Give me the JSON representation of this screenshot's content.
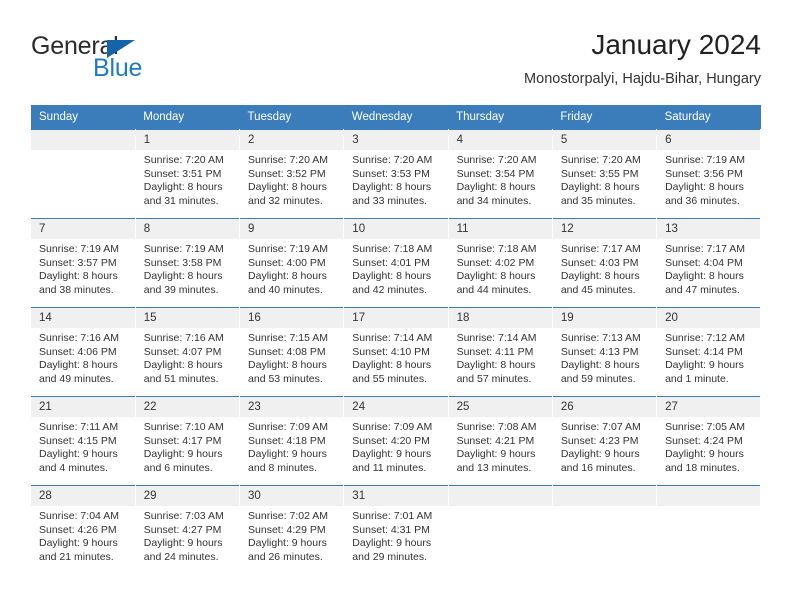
{
  "brand": {
    "name_part1": "General",
    "name_part2": "Blue",
    "logo_icon": "triangle-icon",
    "accent_color": "#1f7bc4"
  },
  "header": {
    "title": "January 2024",
    "subtitle": "Monostorpalyi, Hajdu-Bihar, Hungary"
  },
  "calendar": {
    "header_bg": "#3a7dba",
    "daynum_bg": "#f0f0f0",
    "weekdays": [
      "Sunday",
      "Monday",
      "Tuesday",
      "Wednesday",
      "Thursday",
      "Friday",
      "Saturday"
    ],
    "weeks": [
      [
        {
          "day": "",
          "sunrise": "",
          "sunset": "",
          "daylight_line1": "",
          "daylight_line2": ""
        },
        {
          "day": "1",
          "sunrise": "Sunrise: 7:20 AM",
          "sunset": "Sunset: 3:51 PM",
          "daylight_line1": "Daylight: 8 hours",
          "daylight_line2": "and 31 minutes."
        },
        {
          "day": "2",
          "sunrise": "Sunrise: 7:20 AM",
          "sunset": "Sunset: 3:52 PM",
          "daylight_line1": "Daylight: 8 hours",
          "daylight_line2": "and 32 minutes."
        },
        {
          "day": "3",
          "sunrise": "Sunrise: 7:20 AM",
          "sunset": "Sunset: 3:53 PM",
          "daylight_line1": "Daylight: 8 hours",
          "daylight_line2": "and 33 minutes."
        },
        {
          "day": "4",
          "sunrise": "Sunrise: 7:20 AM",
          "sunset": "Sunset: 3:54 PM",
          "daylight_line1": "Daylight: 8 hours",
          "daylight_line2": "and 34 minutes."
        },
        {
          "day": "5",
          "sunrise": "Sunrise: 7:20 AM",
          "sunset": "Sunset: 3:55 PM",
          "daylight_line1": "Daylight: 8 hours",
          "daylight_line2": "and 35 minutes."
        },
        {
          "day": "6",
          "sunrise": "Sunrise: 7:19 AM",
          "sunset": "Sunset: 3:56 PM",
          "daylight_line1": "Daylight: 8 hours",
          "daylight_line2": "and 36 minutes."
        }
      ],
      [
        {
          "day": "7",
          "sunrise": "Sunrise: 7:19 AM",
          "sunset": "Sunset: 3:57 PM",
          "daylight_line1": "Daylight: 8 hours",
          "daylight_line2": "and 38 minutes."
        },
        {
          "day": "8",
          "sunrise": "Sunrise: 7:19 AM",
          "sunset": "Sunset: 3:58 PM",
          "daylight_line1": "Daylight: 8 hours",
          "daylight_line2": "and 39 minutes."
        },
        {
          "day": "9",
          "sunrise": "Sunrise: 7:19 AM",
          "sunset": "Sunset: 4:00 PM",
          "daylight_line1": "Daylight: 8 hours",
          "daylight_line2": "and 40 minutes."
        },
        {
          "day": "10",
          "sunrise": "Sunrise: 7:18 AM",
          "sunset": "Sunset: 4:01 PM",
          "daylight_line1": "Daylight: 8 hours",
          "daylight_line2": "and 42 minutes."
        },
        {
          "day": "11",
          "sunrise": "Sunrise: 7:18 AM",
          "sunset": "Sunset: 4:02 PM",
          "daylight_line1": "Daylight: 8 hours",
          "daylight_line2": "and 44 minutes."
        },
        {
          "day": "12",
          "sunrise": "Sunrise: 7:17 AM",
          "sunset": "Sunset: 4:03 PM",
          "daylight_line1": "Daylight: 8 hours",
          "daylight_line2": "and 45 minutes."
        },
        {
          "day": "13",
          "sunrise": "Sunrise: 7:17 AM",
          "sunset": "Sunset: 4:04 PM",
          "daylight_line1": "Daylight: 8 hours",
          "daylight_line2": "and 47 minutes."
        }
      ],
      [
        {
          "day": "14",
          "sunrise": "Sunrise: 7:16 AM",
          "sunset": "Sunset: 4:06 PM",
          "daylight_line1": "Daylight: 8 hours",
          "daylight_line2": "and 49 minutes."
        },
        {
          "day": "15",
          "sunrise": "Sunrise: 7:16 AM",
          "sunset": "Sunset: 4:07 PM",
          "daylight_line1": "Daylight: 8 hours",
          "daylight_line2": "and 51 minutes."
        },
        {
          "day": "16",
          "sunrise": "Sunrise: 7:15 AM",
          "sunset": "Sunset: 4:08 PM",
          "daylight_line1": "Daylight: 8 hours",
          "daylight_line2": "and 53 minutes."
        },
        {
          "day": "17",
          "sunrise": "Sunrise: 7:14 AM",
          "sunset": "Sunset: 4:10 PM",
          "daylight_line1": "Daylight: 8 hours",
          "daylight_line2": "and 55 minutes."
        },
        {
          "day": "18",
          "sunrise": "Sunrise: 7:14 AM",
          "sunset": "Sunset: 4:11 PM",
          "daylight_line1": "Daylight: 8 hours",
          "daylight_line2": "and 57 minutes."
        },
        {
          "day": "19",
          "sunrise": "Sunrise: 7:13 AM",
          "sunset": "Sunset: 4:13 PM",
          "daylight_line1": "Daylight: 8 hours",
          "daylight_line2": "and 59 minutes."
        },
        {
          "day": "20",
          "sunrise": "Sunrise: 7:12 AM",
          "sunset": "Sunset: 4:14 PM",
          "daylight_line1": "Daylight: 9 hours",
          "daylight_line2": "and 1 minute."
        }
      ],
      [
        {
          "day": "21",
          "sunrise": "Sunrise: 7:11 AM",
          "sunset": "Sunset: 4:15 PM",
          "daylight_line1": "Daylight: 9 hours",
          "daylight_line2": "and 4 minutes."
        },
        {
          "day": "22",
          "sunrise": "Sunrise: 7:10 AM",
          "sunset": "Sunset: 4:17 PM",
          "daylight_line1": "Daylight: 9 hours",
          "daylight_line2": "and 6 minutes."
        },
        {
          "day": "23",
          "sunrise": "Sunrise: 7:09 AM",
          "sunset": "Sunset: 4:18 PM",
          "daylight_line1": "Daylight: 9 hours",
          "daylight_line2": "and 8 minutes."
        },
        {
          "day": "24",
          "sunrise": "Sunrise: 7:09 AM",
          "sunset": "Sunset: 4:20 PM",
          "daylight_line1": "Daylight: 9 hours",
          "daylight_line2": "and 11 minutes."
        },
        {
          "day": "25",
          "sunrise": "Sunrise: 7:08 AM",
          "sunset": "Sunset: 4:21 PM",
          "daylight_line1": "Daylight: 9 hours",
          "daylight_line2": "and 13 minutes."
        },
        {
          "day": "26",
          "sunrise": "Sunrise: 7:07 AM",
          "sunset": "Sunset: 4:23 PM",
          "daylight_line1": "Daylight: 9 hours",
          "daylight_line2": "and 16 minutes."
        },
        {
          "day": "27",
          "sunrise": "Sunrise: 7:05 AM",
          "sunset": "Sunset: 4:24 PM",
          "daylight_line1": "Daylight: 9 hours",
          "daylight_line2": "and 18 minutes."
        }
      ],
      [
        {
          "day": "28",
          "sunrise": "Sunrise: 7:04 AM",
          "sunset": "Sunset: 4:26 PM",
          "daylight_line1": "Daylight: 9 hours",
          "daylight_line2": "and 21 minutes."
        },
        {
          "day": "29",
          "sunrise": "Sunrise: 7:03 AM",
          "sunset": "Sunset: 4:27 PM",
          "daylight_line1": "Daylight: 9 hours",
          "daylight_line2": "and 24 minutes."
        },
        {
          "day": "30",
          "sunrise": "Sunrise: 7:02 AM",
          "sunset": "Sunset: 4:29 PM",
          "daylight_line1": "Daylight: 9 hours",
          "daylight_line2": "and 26 minutes."
        },
        {
          "day": "31",
          "sunrise": "Sunrise: 7:01 AM",
          "sunset": "Sunset: 4:31 PM",
          "daylight_line1": "Daylight: 9 hours",
          "daylight_line2": "and 29 minutes."
        },
        {
          "day": "",
          "sunrise": "",
          "sunset": "",
          "daylight_line1": "",
          "daylight_line2": ""
        },
        {
          "day": "",
          "sunrise": "",
          "sunset": "",
          "daylight_line1": "",
          "daylight_line2": ""
        },
        {
          "day": "",
          "sunrise": "",
          "sunset": "",
          "daylight_line1": "",
          "daylight_line2": ""
        }
      ]
    ]
  }
}
